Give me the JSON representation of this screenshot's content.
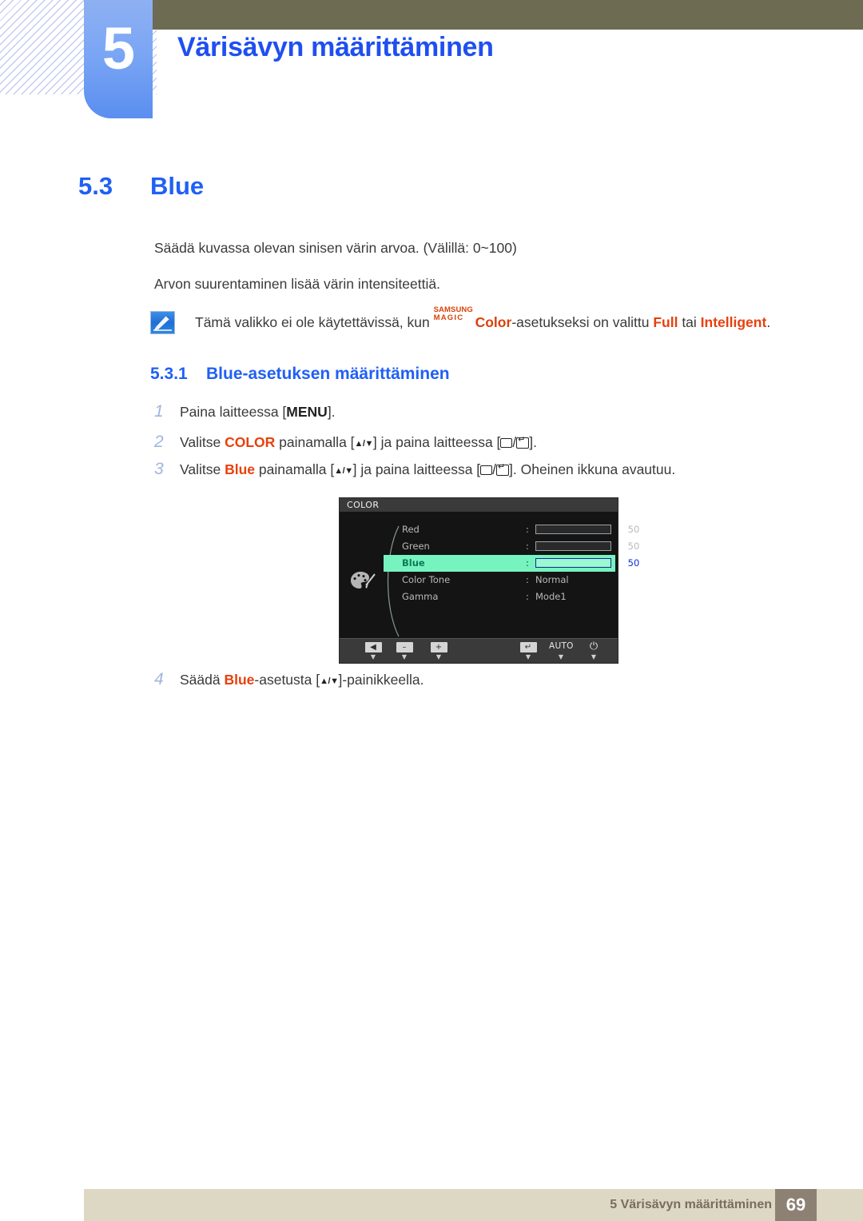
{
  "header": {
    "chapter_number": "5",
    "chapter_title": "Värisävyn määrittäminen",
    "olive_color": "#6d6b52",
    "tab_color": "#7ba6f4",
    "title_color": "#1f4ff0"
  },
  "section": {
    "number": "5.3",
    "title": "Blue"
  },
  "body": {
    "paragraph1": "Säädä kuvassa olevan sinisen värin arvoa. (Välillä: 0~100)",
    "paragraph2": "Arvon suurentaminen lisää värin intensiteettiä."
  },
  "note": {
    "icon": "note-pen-icon",
    "text_before": "Tämä valikko ei ole käytettävissä, kun ",
    "magic_top": "SAMSUNG",
    "magic_bottom": "MAGIC",
    "color_word": "Color",
    "text_middle": "-asetukseksi on valittu ",
    "option1": "Full",
    "text_between": " tai ",
    "option2": "Intelligent",
    "text_end": ".",
    "accent_color": "#d9420b"
  },
  "subsection": {
    "number": "5.3.1",
    "title": "Blue-asetuksen määrittäminen"
  },
  "steps": [
    {
      "number": "1",
      "parts": [
        {
          "t": "Paina laitteessa [",
          "s": "plain"
        },
        {
          "t": "MENU",
          "s": "kbd"
        },
        {
          "t": "].",
          "s": "plain"
        }
      ]
    },
    {
      "number": "2",
      "parts": [
        {
          "t": "Valitse ",
          "s": "plain"
        },
        {
          "t": "COLOR",
          "s": "orange"
        },
        {
          "t": " painamalla [",
          "s": "plain"
        },
        {
          "t": "▲/▼",
          "s": "updn"
        },
        {
          "t": "] ja paina laitteessa [",
          "s": "plain"
        },
        {
          "t": "rect",
          "s": "rect-ico"
        },
        {
          "t": "/",
          "s": "plain"
        },
        {
          "t": "enter",
          "s": "enter-ico"
        },
        {
          "t": "].",
          "s": "plain"
        }
      ]
    },
    {
      "number": "3",
      "parts": [
        {
          "t": "Valitse ",
          "s": "plain"
        },
        {
          "t": "Blue",
          "s": "orange"
        },
        {
          "t": " painamalla [",
          "s": "plain"
        },
        {
          "t": "▲/▼",
          "s": "updn"
        },
        {
          "t": "] ja paina laitteessa [",
          "s": "plain"
        },
        {
          "t": "rect",
          "s": "rect-ico"
        },
        {
          "t": "/",
          "s": "plain"
        },
        {
          "t": "enter",
          "s": "enter-ico"
        },
        {
          "t": "]. Oheinen ikkuna avautuu.",
          "s": "plain"
        }
      ]
    },
    {
      "number": "4",
      "parts": [
        {
          "t": "Säädä ",
          "s": "plain"
        },
        {
          "t": "Blue",
          "s": "orange"
        },
        {
          "t": "-asetusta [",
          "s": "plain"
        },
        {
          "t": "▲/▼",
          "s": "updn"
        },
        {
          "t": "]-painikkeella.",
          "s": "plain"
        }
      ]
    }
  ],
  "osd": {
    "title": "COLOR",
    "icon": "palette-icon",
    "rows": [
      {
        "label": "Red",
        "type": "bar",
        "value": "50",
        "fill_pct": 50,
        "highlight": false
      },
      {
        "label": "Green",
        "type": "bar",
        "value": "50",
        "fill_pct": 50,
        "highlight": false
      },
      {
        "label": "Blue",
        "type": "bar",
        "value": "50",
        "fill_pct": 50,
        "highlight": true
      },
      {
        "label": "Color Tone",
        "type": "text",
        "value": "Normal",
        "highlight": false
      },
      {
        "label": "Gamma",
        "type": "text",
        "value": "Mode1",
        "highlight": false
      }
    ],
    "highlight_color": "#77f3c0",
    "highlight_fill_color": "#2244ee",
    "footer_buttons": [
      {
        "name": "left-arrow-button",
        "glyph": "◀",
        "kind": "box"
      },
      {
        "name": "minus-button",
        "glyph": "–",
        "kind": "box"
      },
      {
        "name": "plus-button",
        "glyph": "+",
        "kind": "box"
      },
      {
        "name": "enter-button",
        "glyph": "↵",
        "kind": "box"
      },
      {
        "name": "auto-button",
        "glyph": "AUTO",
        "kind": "text"
      },
      {
        "name": "power-button",
        "glyph": "⏻",
        "kind": "plain"
      }
    ]
  },
  "footer": {
    "text": "5 Värisävyn määrittäminen",
    "page_number": "69",
    "bar_color": "#ddd8c4",
    "page_box_color": "#8d8174"
  }
}
